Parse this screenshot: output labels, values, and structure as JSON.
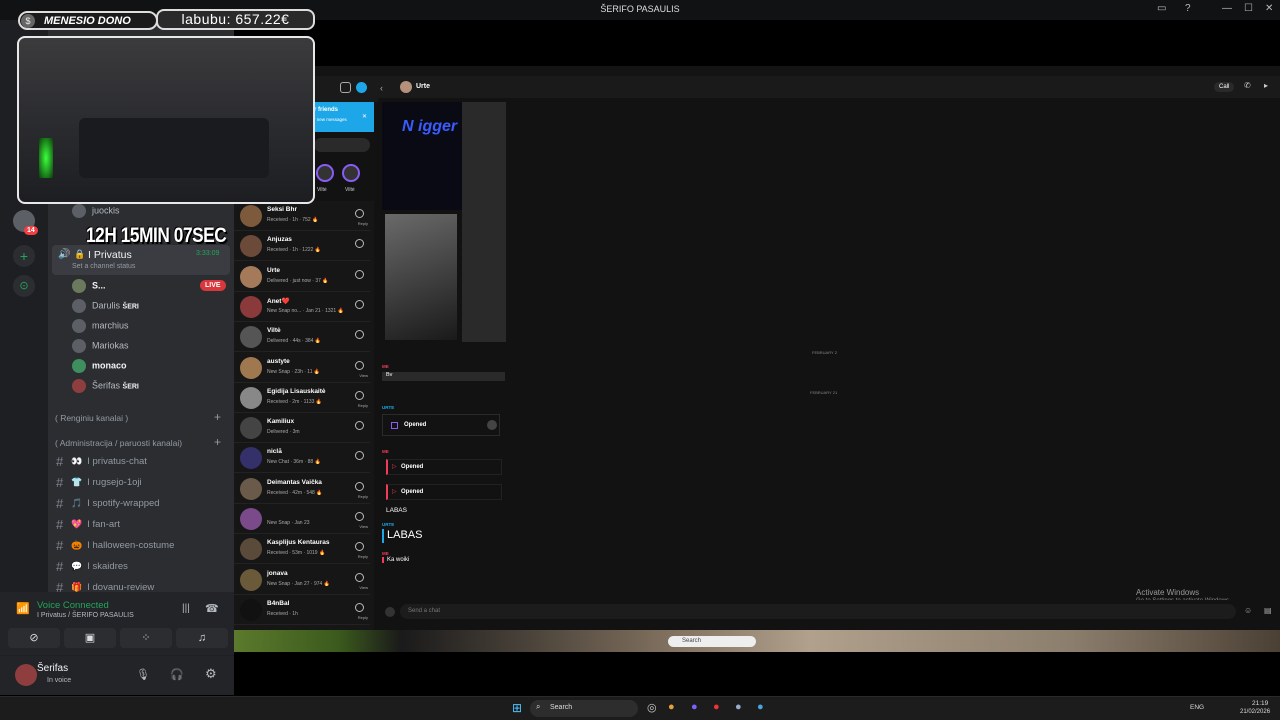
{
  "titlebar": {
    "title": "ŠERIFO PASAULIS"
  },
  "overlay": {
    "dono_label": "MENESIO DONO",
    "dono_amount": "labubu: 657.22€",
    "timer": "12H 15MIN 07SEC"
  },
  "servers": {
    "badge": "14"
  },
  "channels": {
    "server_name_partial": "ŠERIFO PASAULIS",
    "top_user": "juockis",
    "voice_channel": "I Privatus",
    "voice_timer": "3:33:09",
    "channel_status": "Set a channel status",
    "voice_users": [
      {
        "name": "S...",
        "badge": "LIVE"
      },
      {
        "name": "Darulis",
        "tag": "ŠERI"
      },
      {
        "name": "marchius"
      },
      {
        "name": "Mariokas"
      },
      {
        "name": "monaco"
      },
      {
        "name": "Šerifas",
        "tag": "ŠERI"
      }
    ],
    "category1": "( Renginiu kanalai )",
    "category2": "( Administracija / paruosti kanalai)",
    "text_channels": [
      {
        "emoji": "👀",
        "name": "I privatus-chat"
      },
      {
        "emoji": "👕",
        "name": "I rugsejo-1oji"
      },
      {
        "emoji": "🎵",
        "name": "I spotify-wrapped"
      },
      {
        "emoji": "💖",
        "name": "I fan-art"
      },
      {
        "emoji": "🎃",
        "name": "I halloween-costume"
      },
      {
        "emoji": "💬",
        "name": "I skaidres"
      },
      {
        "emoji": "🎁",
        "name": "I dovanu-review"
      }
    ]
  },
  "voice_panel": {
    "status": "Voice Connected",
    "location": "I Privatus / ŠERIFO PASAULIS"
  },
  "user_panel": {
    "name": "Šerifas",
    "status": "In voice"
  },
  "snap": {
    "banner_title": "r friends",
    "banner_sub": "r new messages",
    "header_name": "Urte",
    "call_label": "Call",
    "stories": [
      "Viltė",
      "Viltė"
    ],
    "chats": [
      {
        "name": "Seksi Bhr",
        "status": "Received · 1h · 752 🔥",
        "action": "Reply"
      },
      {
        "name": "Anjuzas",
        "status": "Received · 1h · 1222 🔥",
        "action": ""
      },
      {
        "name": "Urte",
        "status": "Delivered · just now · 37 🔥",
        "action": ""
      },
      {
        "name": "Anet❤️",
        "status": "New Snap no... · Jan 21 · 1321 🔥",
        "action": ""
      },
      {
        "name": "Viltė",
        "status": "Delivered · 44s · 384 🔥",
        "action": ""
      },
      {
        "name": "austyte",
        "status": "New Snap · 23h · 11 🔥",
        "action": "View"
      },
      {
        "name": "Egidija Lisauskaitė",
        "status": "Received · 2m · 1133 🔥",
        "action": "Reply"
      },
      {
        "name": "Kamiliux",
        "status": "Delivered · 3m",
        "action": ""
      },
      {
        "name": "niclā",
        "status": "New Chat · 36m · 88 🔥",
        "action": ""
      },
      {
        "name": "Deimantas Vaička",
        "status": "Received · 42m · 548 🔥",
        "action": "Reply"
      },
      {
        "name": "",
        "status": "New Snap · Jan 23",
        "action": "View"
      },
      {
        "name": "Kasplijus Kentauras",
        "status": "Received · 53m · 1019 🔥",
        "action": "Reply"
      },
      {
        "name": "jonava",
        "status": "New Snap · Jan 27 · 974 🔥",
        "action": "View"
      },
      {
        "name": "B4nBal",
        "status": "Received · 1h",
        "action": "Reply"
      }
    ],
    "chat": {
      "image_text": "N igger",
      "date1": "FEBRUARY 2",
      "me_label1": "ME",
      "msg_bv": "Bv",
      "date2": "FEBRUARY 21",
      "urte_label1": "URTE",
      "opened1": "Opened",
      "me_label2": "ME",
      "opened2": "Opened",
      "opened3": "Opened",
      "msg_labas_small": "LABAS",
      "urte_label2": "URTE",
      "msg_labas_big": "LABAS",
      "me_label3": "ME",
      "msg_ka_woiki": "Ka woiki",
      "input_placeholder": "Send a chat",
      "activate_title": "Activate Windows",
      "activate_sub": "Go to Settings to activate Windows."
    }
  },
  "inner_taskbar": {
    "search": "Search"
  },
  "taskbar": {
    "search": "Search",
    "lang": "ENG",
    "time": "21:19",
    "date": "21/02/2026"
  }
}
